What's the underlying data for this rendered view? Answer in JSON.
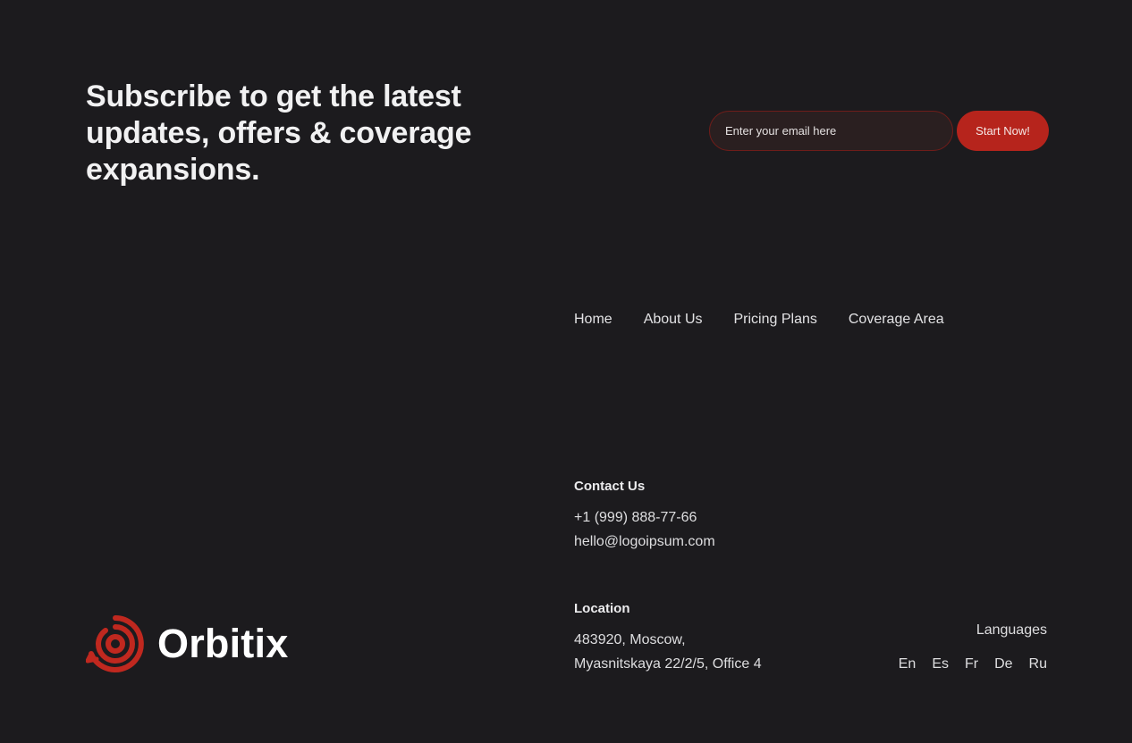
{
  "subscribe": {
    "headline": "Subscribe to get the latest updates, offers & coverage expansions.",
    "email_placeholder": "Enter your email here",
    "button_label": "Start Now!"
  },
  "nav": {
    "items": [
      {
        "label": "Home"
      },
      {
        "label": "About Us"
      },
      {
        "label": "Pricing Plans"
      },
      {
        "label": "Coverage Area"
      }
    ]
  },
  "contact": {
    "title": "Contact Us",
    "phone": "+1 (999) 888-77-66",
    "email": "hello@logoipsum.com"
  },
  "location": {
    "title": "Location",
    "line1": "483920, Moscow,",
    "line2": "Myasnitskaya 22/2/5, Office 4"
  },
  "brand": {
    "name": "Orbitix",
    "logo_icon": "orbit-logo-icon",
    "accent_color": "#c0281f"
  },
  "languages": {
    "label": "Languages",
    "items": [
      "En",
      "Es",
      "Fr",
      "De",
      "Ru"
    ]
  }
}
